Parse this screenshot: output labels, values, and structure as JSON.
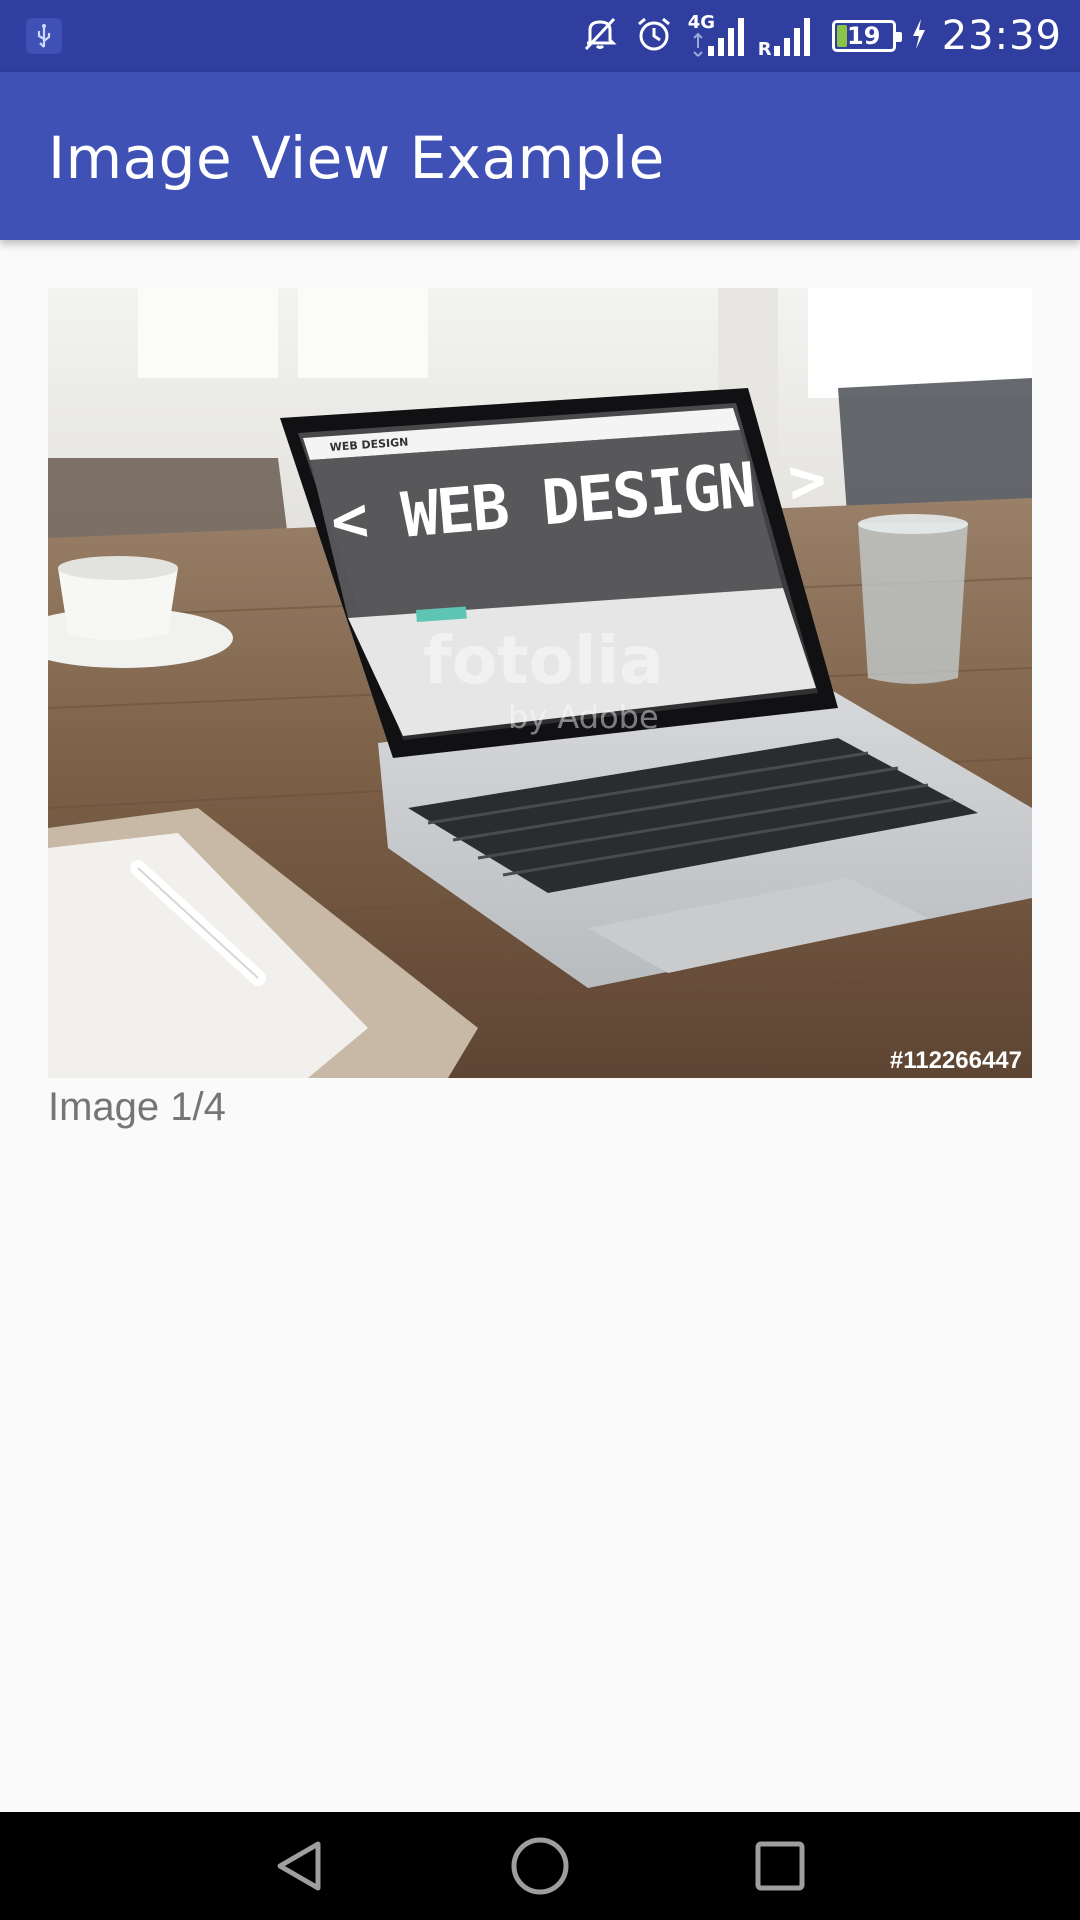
{
  "status_bar": {
    "time": "23:39",
    "battery_level": "19",
    "battery_fraction": 0.19,
    "network_type": "4G",
    "roaming_label": "R",
    "icons": [
      "usb-icon",
      "mute-icon",
      "alarm-icon",
      "signal-icon",
      "roaming-signal-icon",
      "battery-icon",
      "charging-icon"
    ]
  },
  "app_bar": {
    "title": "Image View Example"
  },
  "image": {
    "screen_text": "< WEB DESIGN >",
    "watermark": "fotolia",
    "watermark_sub": "by Adobe",
    "stock_id": "#112266447",
    "caption": "Image 1/4"
  },
  "nav_bar": {
    "icons": [
      "back-icon",
      "home-icon",
      "recents-icon"
    ]
  },
  "colors": {
    "primary": "#3f51b5",
    "primary_dark": "#303f9f",
    "background": "#fafafa",
    "caption_text": "#757575"
  }
}
